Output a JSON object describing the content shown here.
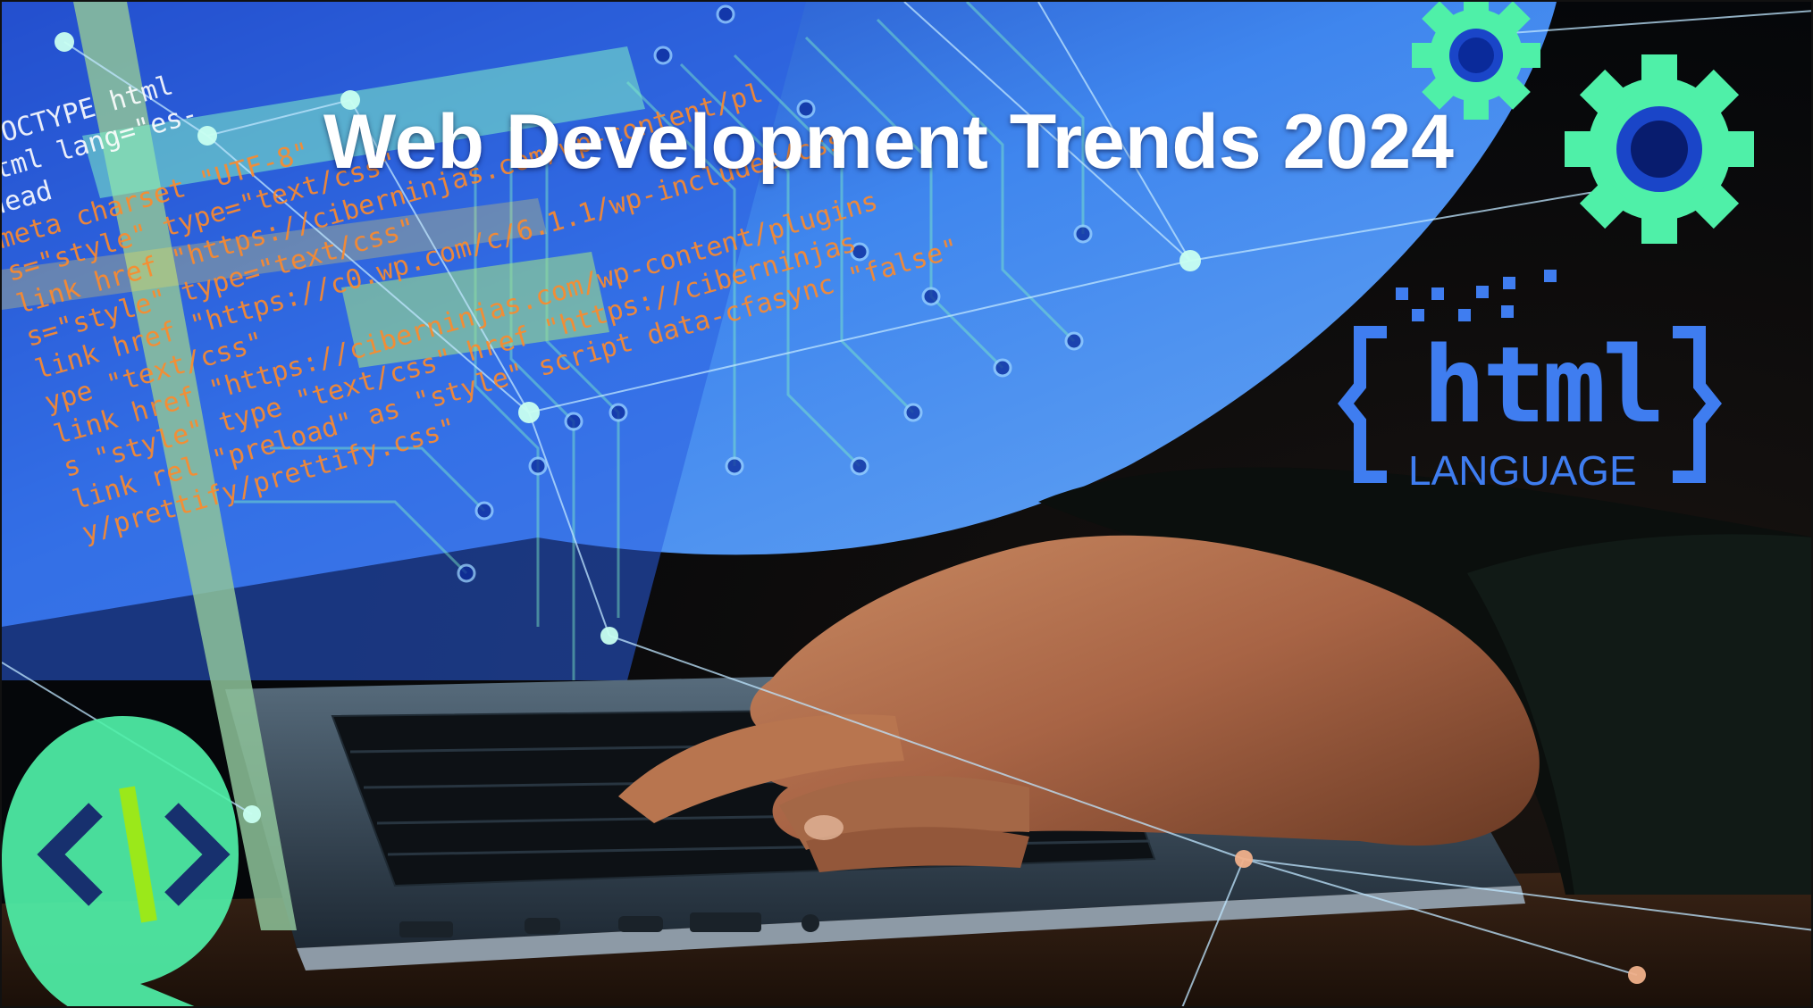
{
  "banner": {
    "title": "Web Development Trends 2024"
  },
  "html_logo": {
    "word": "html",
    "subtitle": "LANGUAGE"
  },
  "code_text": [
    "!DOCTYPE html",
    "html lang=\"es-",
    "head",
    "meta charset \"UTF-8\"",
    "s=\"style\" type=\"text/css\"",
    "link href \"https://ciberninjas.com/wp-content/pl",
    "s=\"style\" type=\"text/css\"",
    "link href \"https://c0.wp.com/c/6.1.1/wp-includes/css",
    "ype \"text/css\"",
    "link href \"https://ciberninjas.com/wp-content/plugins",
    "s \"style\" type \"text/css\" href \"https://ciberninjas",
    "link rel \"preload\" as \"style\" script data-cfasync \"false\"",
    "y/prettify/prettify.css\""
  ],
  "colors": {
    "accent_green": "#4ff0a8",
    "accent_blue": "#3f7df0",
    "screen_blue": "#2f6fe6"
  },
  "icons": [
    "gear-icon",
    "gear-icon",
    "code-brackets-icon"
  ]
}
